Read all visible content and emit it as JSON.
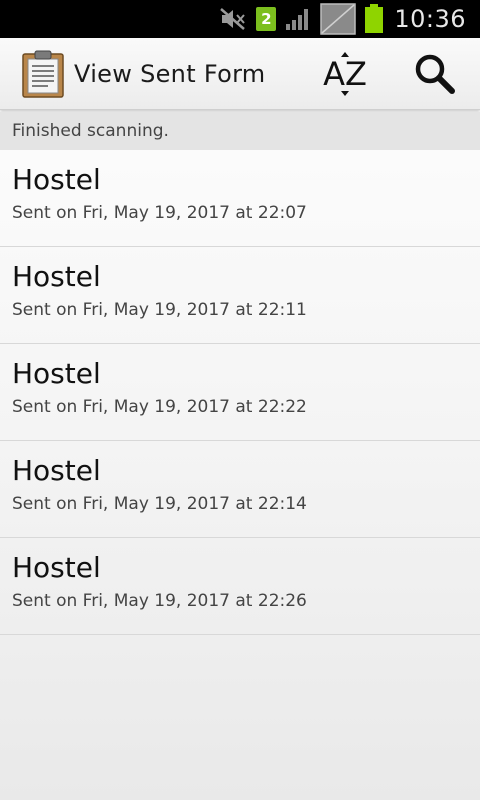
{
  "status_bar": {
    "time": "10:36",
    "sim_number": "2",
    "icons": [
      "mute-icon",
      "sim-icon",
      "signal-icon",
      "no-signal-icon",
      "battery-icon"
    ]
  },
  "action_bar": {
    "title": "View Sent Form",
    "sort_label": "AZ",
    "icons": [
      "clipboard-icon",
      "sort-az-icon",
      "search-icon"
    ]
  },
  "scan_status": "Finished scanning.",
  "forms": [
    {
      "title": "Hostel",
      "subtitle": "Sent on Fri, May 19, 2017 at 22:07"
    },
    {
      "title": "Hostel",
      "subtitle": "Sent on Fri, May 19, 2017 at 22:11"
    },
    {
      "title": "Hostel",
      "subtitle": "Sent on Fri, May 19, 2017 at 22:22"
    },
    {
      "title": "Hostel",
      "subtitle": "Sent on Fri, May 19, 2017 at 22:14"
    },
    {
      "title": "Hostel",
      "subtitle": "Sent on Fri, May 19, 2017 at 22:26"
    }
  ],
  "colors": {
    "status_bar_bg": "#000000",
    "battery_green": "#8fd400",
    "sim_badge_green": "#7cbf1e",
    "action_bar_bg": "#f2f2f2",
    "scan_bar_bg": "#e4e4e4"
  }
}
